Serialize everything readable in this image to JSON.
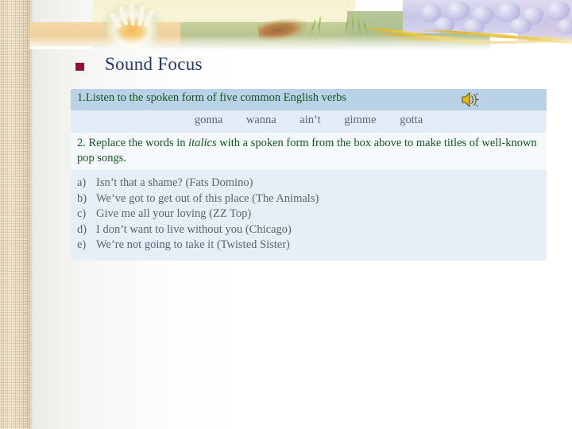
{
  "slide": {
    "title": "Sound Focus",
    "title_bullet": "square-bullet",
    "banner": "decorative-floral-banner"
  },
  "exercise_one": {
    "instruction": "1.Listen to the spoken form of five common English verbs",
    "sound_icon": "speaker-icon",
    "words": [
      "gonna",
      "wanna",
      "ain’t",
      "gimme",
      "gotta"
    ]
  },
  "exercise_two": {
    "instruction_part1": "2. Replace the words in ",
    "instruction_italic": "italics",
    "instruction_part2": " with a spoken form from the box above to make titles of well-known pop songs.",
    "songs": [
      {
        "label": "a)",
        "text": "Isn’t that a shame?  (Fats Domino)"
      },
      {
        "label": "b)",
        "text": "We’ve got to get out of this place (The Animals)"
      },
      {
        "label": "c)",
        "text": "Give me all your loving (ZZ Top)"
      },
      {
        "label": "d)",
        "text": "I don’t want to live without you (Chicago)"
      },
      {
        "label": "e)",
        "text": "We’re not going to take it (Twisted Sister)"
      }
    ]
  },
  "colors": {
    "title_text": "#21386b",
    "title_bullet": "#9a0f33",
    "green_text": "#14571f",
    "list_text": "#596570",
    "band_header_bg": "#b9d2e8",
    "band_words_bg": "#e4ecf7",
    "band_instruction_bg": "#f6f9fc",
    "band_list_bg": "#e6eef8",
    "left_strip": "#e4d5b4"
  }
}
